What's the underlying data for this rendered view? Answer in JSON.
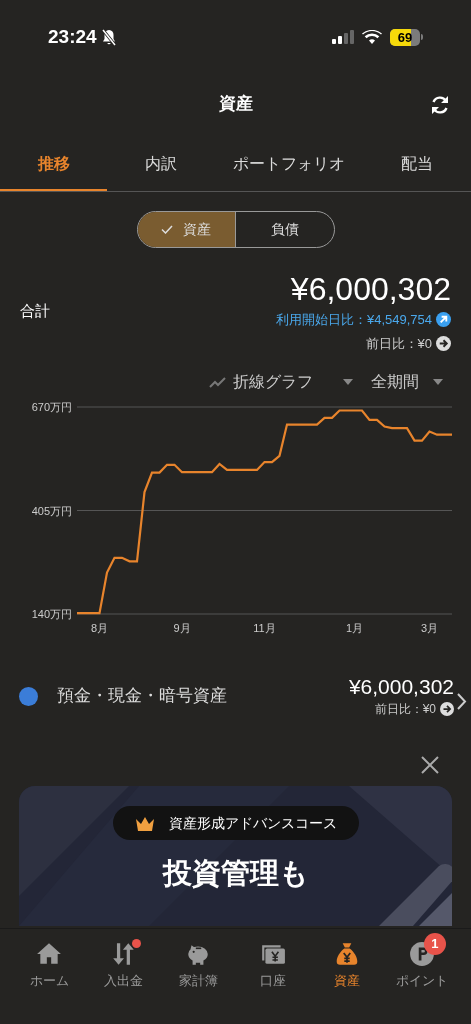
{
  "status_bar": {
    "time": "23:24",
    "battery": "69"
  },
  "header": {
    "title": "資産"
  },
  "tabs": [
    {
      "label": "推移",
      "selected": true
    },
    {
      "label": "内訳",
      "selected": false
    },
    {
      "label": "ポートフォリオ",
      "selected": false
    },
    {
      "label": "配当",
      "selected": false
    }
  ],
  "segments": [
    {
      "label": "資産",
      "selected": true
    },
    {
      "label": "負債",
      "selected": false
    }
  ],
  "summary": {
    "label": "合計",
    "total": "¥6,000,302",
    "since_start": "利用開始日比：¥4,549,754",
    "day_change": "前日比：¥0"
  },
  "chart_controls": {
    "chart_type": "折線グラフ",
    "period": "全期間"
  },
  "chart_data": {
    "type": "line",
    "ylim": [
      140,
      670
    ],
    "yticks": [
      {
        "value": 140,
        "label": "140万円"
      },
      {
        "value": 405,
        "label": "405万円"
      },
      {
        "value": 670,
        "label": "670万円"
      }
    ],
    "categories": [
      null,
      null,
      null,
      "8月",
      null,
      null,
      null,
      null,
      null,
      null,
      null,
      null,
      null,
      null,
      "9月",
      null,
      null,
      null,
      null,
      null,
      null,
      null,
      null,
      null,
      null,
      "11月",
      null,
      null,
      null,
      null,
      null,
      null,
      null,
      null,
      null,
      null,
      null,
      "1月",
      null,
      null,
      null,
      null,
      null,
      null,
      null,
      null,
      null,
      "3月",
      null,
      null,
      null
    ],
    "series": [
      {
        "color": "#e8842c",
        "values": [
          142,
          142,
          142,
          142,
          246,
          284,
          284,
          275,
          275,
          452,
          502,
          502,
          522,
          522,
          503,
          503,
          503,
          503,
          503,
          524,
          509,
          509,
          509,
          509,
          509,
          529,
          529,
          545,
          625,
          625,
          625,
          625,
          625,
          642,
          642,
          661,
          661,
          661,
          661,
          637,
          637,
          620,
          616,
          616,
          616,
          584,
          584,
          607,
          599,
          599,
          599
        ]
      }
    ]
  },
  "accounts": [
    {
      "name": "預金・現金・暗号資産",
      "color": "#3b7dd8",
      "amount": "¥6,000,302",
      "day_change": "前日比：¥0"
    }
  ],
  "banner": {
    "badge": "資産形成アドバンスコース",
    "heading": "投資管理も"
  },
  "bottom_nav": [
    {
      "label": "ホーム",
      "selected": false,
      "dot": false
    },
    {
      "label": "入出金",
      "selected": false,
      "dot": true
    },
    {
      "label": "家計簿",
      "selected": false,
      "dot": false
    },
    {
      "label": "口座",
      "selected": false,
      "dot": false
    },
    {
      "label": "資産",
      "selected": true,
      "dot": false
    },
    {
      "label": "ポイント",
      "selected": false,
      "dot": false,
      "badge": "1"
    }
  ]
}
